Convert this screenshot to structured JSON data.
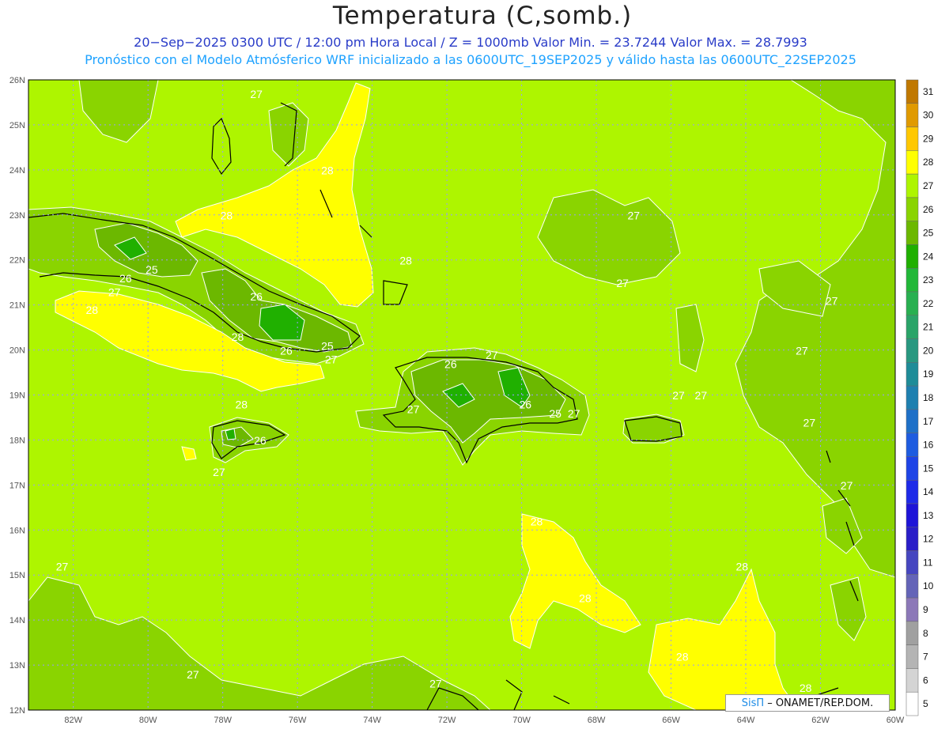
{
  "header": {
    "title": "Temperatura (C,somb.)",
    "subtitle1": "20−Sep−2025 0300 UTC / 12:00 pm Hora Local / Z = 1000mb   Valor Min. = 23.7244  Valor Max. = 28.7993",
    "subtitle2": "Pronóstico con el Modelo Atmósferico WRF inicializado a las 0600UTC_19SEP2025 y válido hasta las  0600UTC_22SEP2025"
  },
  "credit": {
    "brand": "SisΠ",
    "text": "– ONAMET/REP.DOM."
  },
  "map": {
    "lon_range": [
      -83.2,
      -60
    ],
    "lat_range": [
      12,
      26
    ],
    "lat_labels": [
      "26N",
      "25N",
      "24N",
      "23N",
      "22N",
      "21N",
      "20N",
      "19N",
      "18N",
      "17N",
      "16N",
      "15N",
      "14N",
      "13N",
      "12N"
    ],
    "lat_values": [
      26,
      25,
      24,
      23,
      22,
      21,
      20,
      19,
      18,
      17,
      16,
      15,
      14,
      13,
      12
    ],
    "lon_labels": [
      "82W",
      "80W",
      "78W",
      "76W",
      "74W",
      "72W",
      "70W",
      "68W",
      "66W",
      "64W",
      "62W",
      "60W"
    ],
    "lon_values": [
      -82,
      -80,
      -78,
      -76,
      -74,
      -72,
      -70,
      -68,
      -66,
      -64,
      -62,
      -60
    ],
    "base_color": "#aef500",
    "contour_labels": [
      {
        "text": "27",
        "lon": -77.1,
        "lat": 25.6
      },
      {
        "text": "28",
        "lon": -75.2,
        "lat": 23.9
      },
      {
        "text": "28",
        "lon": -77.9,
        "lat": 22.9
      },
      {
        "text": "28",
        "lon": -73.1,
        "lat": 21.9
      },
      {
        "text": "25",
        "lon": -79.9,
        "lat": 21.7
      },
      {
        "text": "26",
        "lon": -80.6,
        "lat": 21.5
      },
      {
        "text": "27",
        "lon": -80.9,
        "lat": 21.2
      },
      {
        "text": "28",
        "lon": -81.5,
        "lat": 20.8
      },
      {
        "text": "26",
        "lon": -77.1,
        "lat": 21.1
      },
      {
        "text": "28",
        "lon": -77.6,
        "lat": 20.2
      },
      {
        "text": "26",
        "lon": -76.3,
        "lat": 19.9
      },
      {
        "text": "25",
        "lon": -75.2,
        "lat": 20.0
      },
      {
        "text": "27",
        "lon": -75.1,
        "lat": 19.7
      },
      {
        "text": "26",
        "lon": -71.9,
        "lat": 19.6
      },
      {
        "text": "27",
        "lon": -70.8,
        "lat": 19.8
      },
      {
        "text": "27",
        "lon": -72.9,
        "lat": 18.6
      },
      {
        "text": "26",
        "lon": -69.9,
        "lat": 18.7
      },
      {
        "text": "25",
        "lon": -69.1,
        "lat": 18.5
      },
      {
        "text": "27",
        "lon": -68.6,
        "lat": 18.5
      },
      {
        "text": "27",
        "lon": -65.8,
        "lat": 18.9
      },
      {
        "text": "27",
        "lon": -65.2,
        "lat": 18.9
      },
      {
        "text": "27",
        "lon": -67.0,
        "lat": 22.9
      },
      {
        "text": "27",
        "lon": -67.3,
        "lat": 21.4
      },
      {
        "text": "27",
        "lon": -61.7,
        "lat": 21.0
      },
      {
        "text": "27",
        "lon": -62.5,
        "lat": 19.9
      },
      {
        "text": "27",
        "lon": -62.3,
        "lat": 18.3
      },
      {
        "text": "27",
        "lon": -61.3,
        "lat": 16.9
      },
      {
        "text": "28",
        "lon": -77.5,
        "lat": 18.7
      },
      {
        "text": "26",
        "lon": -77.0,
        "lat": 17.9
      },
      {
        "text": "27",
        "lon": -78.1,
        "lat": 17.2
      },
      {
        "text": "28",
        "lon": -69.6,
        "lat": 16.1
      },
      {
        "text": "28",
        "lon": -68.3,
        "lat": 14.4
      },
      {
        "text": "28",
        "lon": -64.1,
        "lat": 15.1
      },
      {
        "text": "28",
        "lon": -65.7,
        "lat": 13.1
      },
      {
        "text": "28",
        "lon": -62.4,
        "lat": 12.4
      },
      {
        "text": "27",
        "lon": -82.3,
        "lat": 15.1
      },
      {
        "text": "27",
        "lon": -78.8,
        "lat": 12.7
      },
      {
        "text": "27",
        "lon": -72.3,
        "lat": 12.5
      }
    ]
  },
  "colorbar": {
    "levels": [
      "31",
      "30",
      "29",
      "28",
      "27",
      "26",
      "25",
      "24",
      "23",
      "22",
      "21",
      "20",
      "19",
      "18",
      "17",
      "16",
      "15",
      "14",
      "13",
      "12",
      "11",
      "10",
      "9",
      "8",
      "7",
      "6",
      "5"
    ],
    "colors": [
      "#c07800",
      "#e09a00",
      "#ffc800",
      "#ffff00",
      "#aef500",
      "#8ad400",
      "#6cb800",
      "#20b000",
      "#22b838",
      "#28b050",
      "#2aa468",
      "#289880",
      "#1e8c98",
      "#1e80b0",
      "#1e70c8",
      "#1e5ce0",
      "#1e44e6",
      "#1e2ae8",
      "#1e14d8",
      "#2a1ec8",
      "#4646c0",
      "#6464b8",
      "#8c78b8",
      "#a0a0a0",
      "#b4b4b4",
      "#d4d4d4",
      "#ffffff"
    ]
  }
}
